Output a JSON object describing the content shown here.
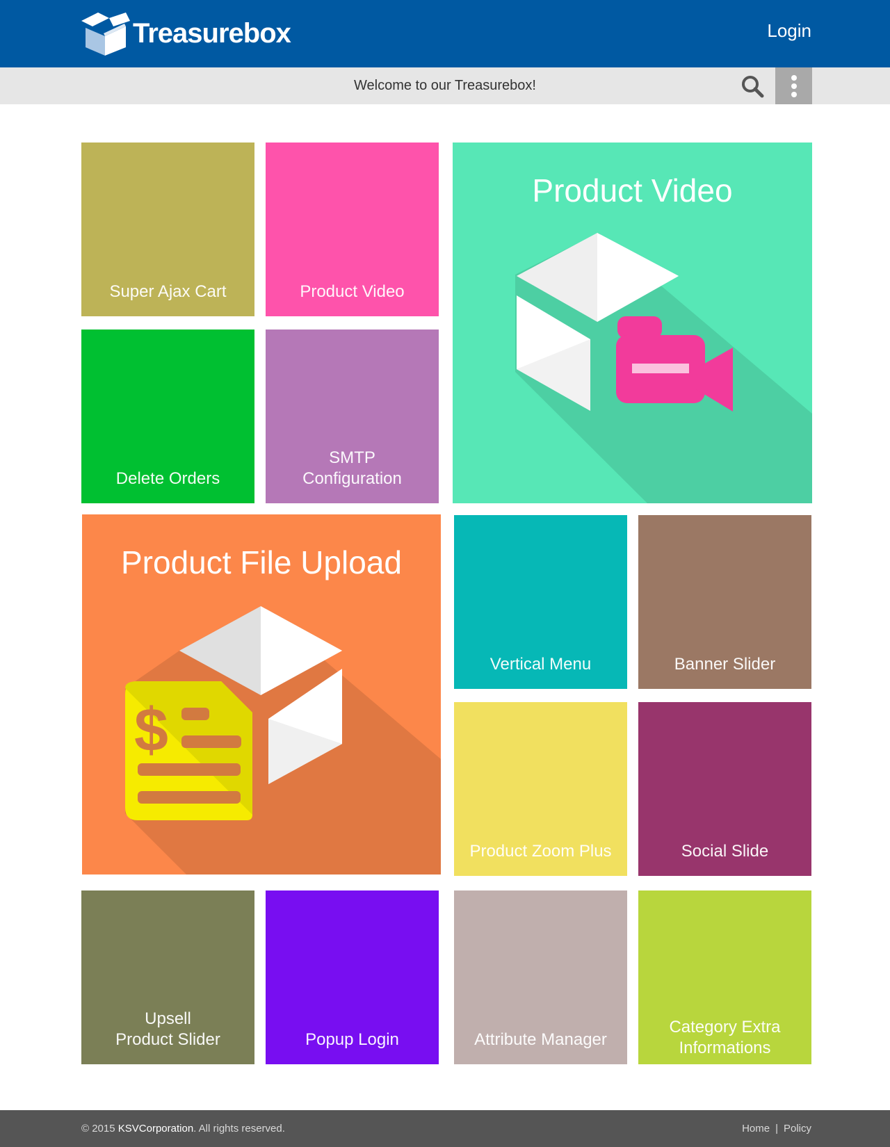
{
  "header": {
    "logo_text": "Treasurebox",
    "login_label": "Login"
  },
  "welcome": {
    "text": "Welcome to our Treasurebox!",
    "search_icon": "search-icon",
    "more_icon": "more-vertical-icon"
  },
  "tiles": {
    "super_ajax_cart": {
      "label": "Super Ajax Cart",
      "color": "#bdb357"
    },
    "product_video_small": {
      "label": "Product Video",
      "color": "#fe53ab"
    },
    "delete_orders": {
      "label": "Delete Orders",
      "color": "#00c031"
    },
    "smtp_configuration": {
      "label": "SMTP\nConfiguration",
      "color": "#b578b7"
    },
    "product_video_big": {
      "title": "Product Video",
      "color": "#57e7b6"
    },
    "product_file_upload": {
      "title": "Product File Upload",
      "color": "#fc874a"
    },
    "vertical_menu": {
      "label": "Vertical Menu",
      "color": "#06b8b6"
    },
    "banner_slider": {
      "label": "Banner Slider",
      "color": "#9b7864"
    },
    "product_zoom_plus": {
      "label": "Product Zoom Plus",
      "color": "#f1e05f"
    },
    "social_slide": {
      "label": "Social Slide",
      "color": "#98356c"
    },
    "upsell_product_slider": {
      "label": "Upsell\nProduct Slider",
      "color": "#7b7f56"
    },
    "popup_login": {
      "label": "Popup Login",
      "color": "#780ef1"
    },
    "attribute_manager": {
      "label": "Attribute Manager",
      "color": "#c0afad"
    },
    "category_extra_informations": {
      "label": "Category Extra\nInformations",
      "color": "#b8d63d"
    }
  },
  "footer": {
    "copyright_prefix": "© 2015 ",
    "copyright_brand": "KSVCorporation",
    "copyright_suffix": ". All rights reserved.",
    "link_home": "Home",
    "link_separator": "|",
    "link_policy": "Policy"
  }
}
